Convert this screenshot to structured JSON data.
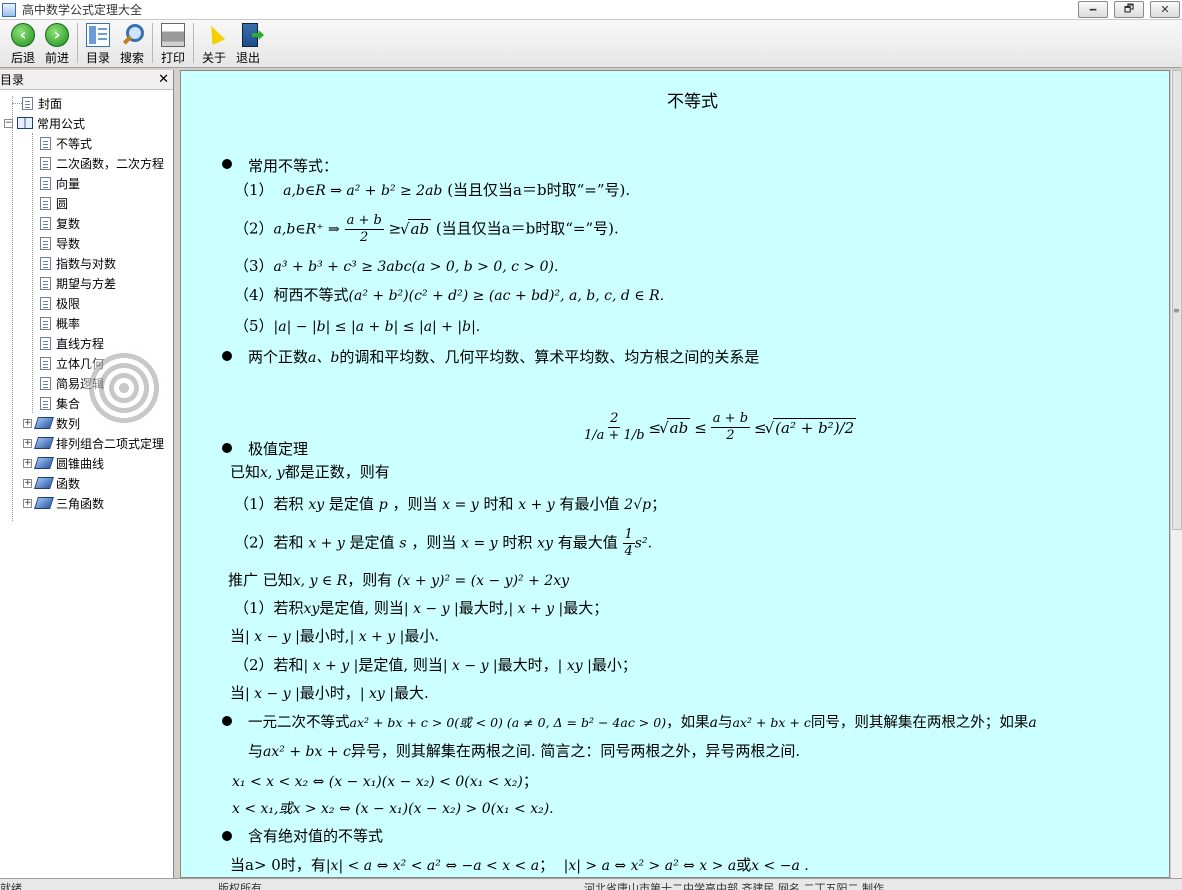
{
  "window": {
    "title": "高中数学公式定理大全",
    "controls": [
      "🗕",
      "🗗",
      "✕"
    ]
  },
  "toolbar": {
    "back": "后退",
    "forward": "前进",
    "toc": "目录",
    "search": "搜索",
    "print": "打印",
    "about": "关于",
    "exit": "退出"
  },
  "sidebar": {
    "header": "目录",
    "close": "✕",
    "items": [
      {
        "label": "封面"
      },
      {
        "label": "常用公式"
      },
      {
        "label": "不等式"
      },
      {
        "label": "二次函数，二次方程"
      },
      {
        "label": "向量"
      },
      {
        "label": "圆"
      },
      {
        "label": "复数"
      },
      {
        "label": "导数"
      },
      {
        "label": "指数与对数"
      },
      {
        "label": "期望与方差"
      },
      {
        "label": "极限"
      },
      {
        "label": "概率"
      },
      {
        "label": "直线方程"
      },
      {
        "label": "立体几何"
      },
      {
        "label": "简易逻辑"
      },
      {
        "label": "集合"
      },
      {
        "label": "数列"
      },
      {
        "label": "排列组合二项式定理"
      },
      {
        "label": "圆锥曲线"
      },
      {
        "label": "函数"
      },
      {
        "label": "三角函数"
      }
    ]
  },
  "content": {
    "title": "不等式",
    "s1": "常用不等式：",
    "l1a": "（1）",
    "l1m": "a,b∈R ⇒ a² + b² ≥ 2ab",
    "l1b": "(当且仅当a＝b时取“=”号).",
    "l2a": "（2）",
    "l2m": "a,b∈R⁺ ⇒",
    "l2num": "a + b",
    "l2den": "2",
    "l2ge": "≥",
    "l2sq": "ab",
    "l2b": "(当且仅当a＝b时取“=”号).",
    "l3a": "（3）",
    "l3m": "a³ + b³ + c³ ≥ 3abc(a > 0, b > 0, c > 0).",
    "l4a": "（4）柯西不等式",
    "l4m": "(a² + b²)(c² + d²) ≥ (ac + bd)², a, b, c, d ∈ R.",
    "l5a": "（5）",
    "l5m": "|a| − |b| ≤ |a + b| ≤ |a| + |b|.",
    "s2a": "两个正数",
    "s2m": "a、b",
    "s2b": "的调和平均数、几何平均数、算术平均数、均方根之间的关系是",
    "hm_num": "2",
    "hm_den": "1/a + 1/b",
    "hm_le1": "≤",
    "hm_gm": "ab",
    "hm_le2": "≤",
    "hm_am_num": "a + b",
    "hm_am_den": "2",
    "hm_le3": "≤",
    "hm_rms": "(a² + b²)/2",
    "s3": "极值定理",
    "s3a": "已知",
    "s3am": "x, y",
    "s3b": "都是正数，则有",
    "e1a": "（1）若积",
    "e1m1": "xy",
    "e1b": "是定值",
    "e1m2": "p",
    "e1c": "，则当",
    "e1m3": "x = y",
    "e1d": "时和",
    "e1m4": "x + y",
    "e1e": "有最小值",
    "e1m5": "2√p",
    "e1f": "；",
    "e2a": "（2）若和",
    "e2m1": "x + y",
    "e2b": "是定值",
    "e2m2": "s",
    "e2c": "，则当",
    "e2m3": "x = y",
    "e2d": "时积",
    "e2m4": "xy",
    "e2e": "有最大值",
    "e2num": "1",
    "e2den": "4",
    "e2m5": "s².",
    "ga": "推广  已知",
    "gm1": "x, y ∈ R",
    "gb": "，则有",
    "gm2": "(x + y)² = (x − y)² + 2xy",
    "g1a": "（1）若积",
    "g1m1": "xy",
    "g1b": "是定值, 则当",
    "g1m2": "| x − y |",
    "g1c": "最大时,",
    "g1m3": "| x + y |",
    "g1d": "最大；",
    "g1e": "当",
    "g1m4": "| x − y |",
    "g1f": "最小时,",
    "g1m5": "| x + y |",
    "g1g": "最小.",
    "g2a": "（2）若和",
    "g2m1": "| x + y |",
    "g2b": "是定值, 则当",
    "g2m2": "| x − y |",
    "g2c": "最大时，",
    "g2m3": "| xy |",
    "g2d": "最小；",
    "g2e": "当",
    "g2m4": "| x − y |",
    "g2f": "最小时，",
    "g2m5": "| xy |",
    "g2g": "最大.",
    "s4a": "一元二次不等式",
    "s4m1": "ax² + bx + c > 0(或 < 0) (a ≠ 0, Δ = b² − 4ac > 0)",
    "s4b": "，如果",
    "s4m2": "a",
    "s4c": "与",
    "s4m3": "ax² + bx + c",
    "s4d": "同号，则其解集在两根之外；如果",
    "s4m4": "a",
    "s4e": "与",
    "s4m5": "ax² + bx + c",
    "s4f": "异号，则其解集在两根之间. 简言之：同号两根之外，异号两根之间.",
    "r1m": "x₁ < x < x₂ ⇔ (x − x₁)(x − x₂) < 0(x₁ < x₂)",
    "r1e": "；",
    "r2m": "x < x₁,或x > x₂ ⇔ (x − x₁)(x − x₂) > 0(x₁ < x₂).",
    "s5": "含有绝对值的不等式",
    "s5a": "当a> 0时，有",
    "s5m1": "|x| < a ⇔ x² < a²  ⇔ −a < x < a",
    "s5b": "；",
    "s5m2": "|x| > a ⇔ x² > a² ⇔ x > a",
    "s5c": "或",
    "s5m3": "x < −a ."
  },
  "status": {
    "left": "就绪",
    "middle": "版权所有",
    "right": "河北省唐山市第十二中学高中部   齐建民  网名  二丁五阳二  制作"
  }
}
